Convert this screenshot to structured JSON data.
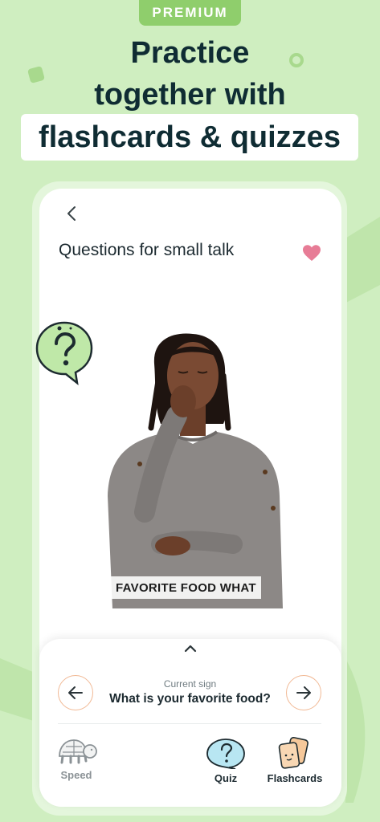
{
  "badge": "PREMIUM",
  "headline": {
    "line1": "Practice",
    "line2": "together with",
    "line3": "flashcards & quizzes"
  },
  "screen": {
    "title": "Questions for small talk",
    "video_caption": "FAVORITE FOOD WHAT",
    "current_label": "Current sign",
    "current_sign": "What is your favorite food?"
  },
  "tabs": {
    "speed": "Speed",
    "quiz": "Quiz",
    "flashcards": "Flashcards"
  },
  "colors": {
    "background": "#cfeec0",
    "badge": "#8fce6c",
    "heart": "#e77c96",
    "nav_border": "#f1b995",
    "quiz_bubble": "#b8e6f2",
    "flashcards": "#f6c89a"
  },
  "icons": [
    "back-chevron-icon",
    "heart-icon",
    "question-bubble-icon",
    "chevron-up-icon",
    "arrow-left-icon",
    "arrow-right-icon",
    "turtle-icon",
    "quiz-icon",
    "flashcards-icon"
  ]
}
